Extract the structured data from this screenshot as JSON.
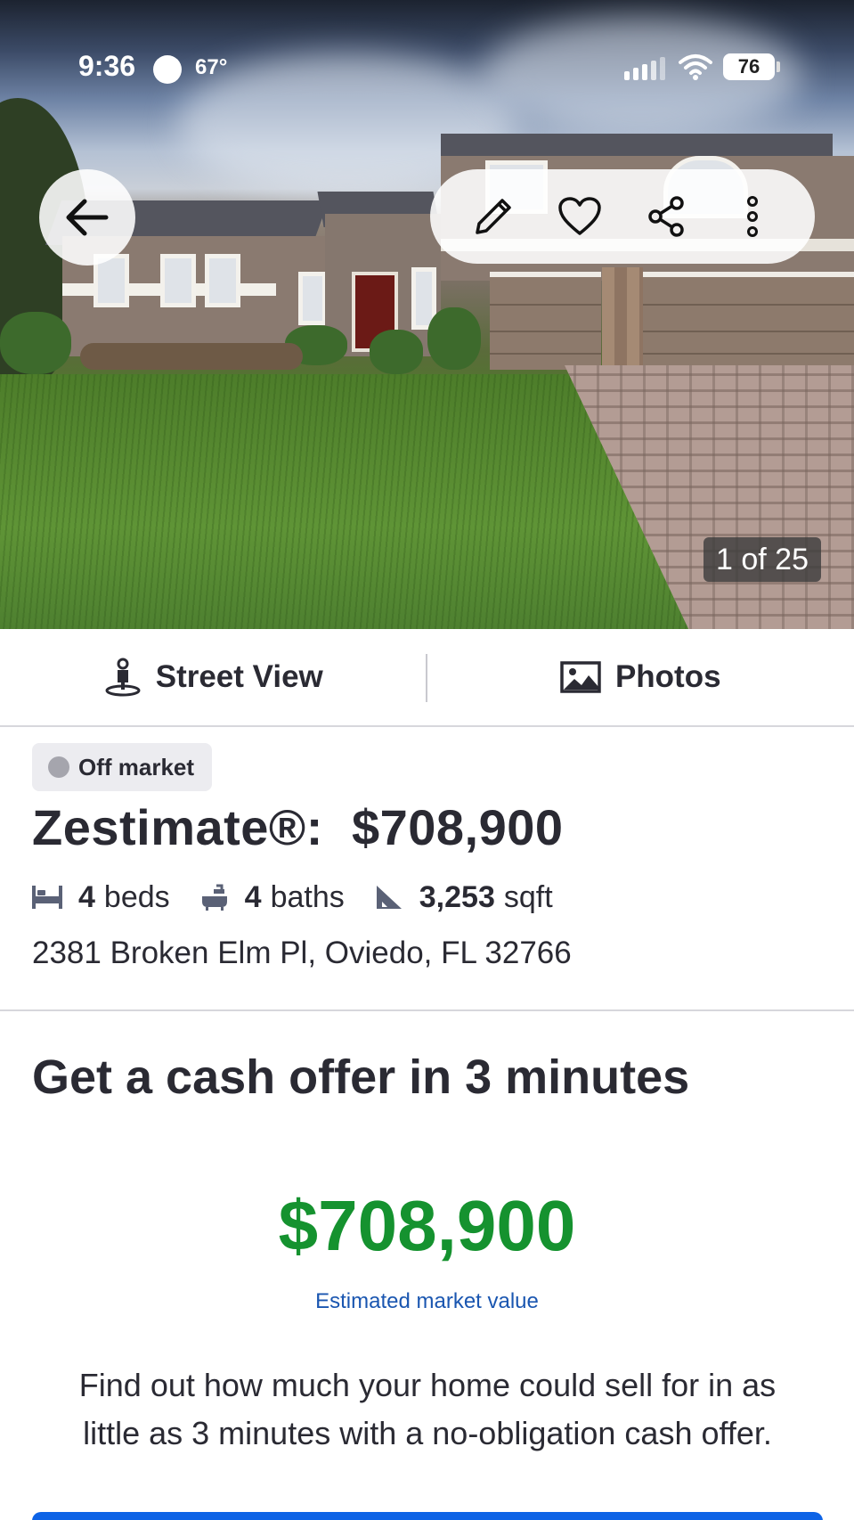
{
  "status_bar": {
    "time": "9:36",
    "temperature": "67°",
    "battery": "76"
  },
  "hero": {
    "photo_counter": "1 of 25"
  },
  "top_actions": {
    "back_icon": "arrow-left-icon",
    "edit_icon": "pencil-icon",
    "save_icon": "heart-icon",
    "share_icon": "share-icon",
    "more_icon": "more-vertical-icon"
  },
  "view_row": {
    "street_view_label": "Street View",
    "photos_label": "Photos"
  },
  "listing": {
    "status_badge": "Off market",
    "zestimate_label": "Zestimate®:  $708,900",
    "beds_value": "4",
    "beds_unit": "beds",
    "baths_value": "4",
    "baths_unit": "baths",
    "sqft_value": "3,253",
    "sqft_unit": "sqft",
    "address": "2381 Broken Elm Pl, Oviedo, FL 32766"
  },
  "cash_offer": {
    "title": "Get a cash offer in 3 minutes",
    "price": "$708,900",
    "price_label": "Estimated market value",
    "description": "Find out how much your home could sell for in as little as 3 minutes with a no-obligation cash offer."
  },
  "colors": {
    "price_green": "#15922f",
    "link_blue": "#1a56b0",
    "cta_blue": "#0d63e6"
  }
}
